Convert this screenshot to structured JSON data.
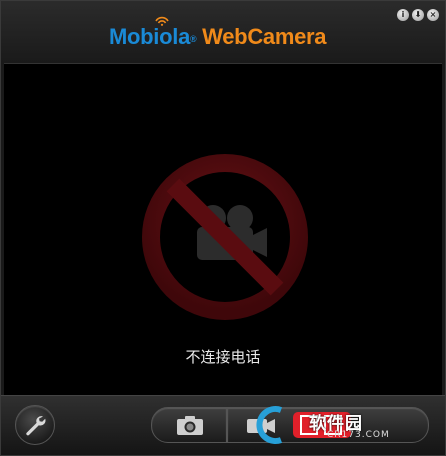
{
  "app": {
    "logo_part1": "Mobiola",
    "logo_reg": "®",
    "logo_part2": " WebCamera",
    "brand_blue": "#1a8ad6",
    "brand_orange": "#f08a1a"
  },
  "window_controls": {
    "info_label": "i",
    "download_label": "⬇",
    "close_label": "×"
  },
  "video": {
    "status_text": "不连接电话",
    "no_sign_color": "#5a0c10",
    "camera_icon": "video-camera-icon"
  },
  "toolbar": {
    "settings_icon": "wrench-icon",
    "snapshot_icon": "photo-camera-icon",
    "record_icon": "video-camera-icon"
  },
  "watermark": {
    "text": "软件园",
    "sub": "CR173.COM"
  }
}
